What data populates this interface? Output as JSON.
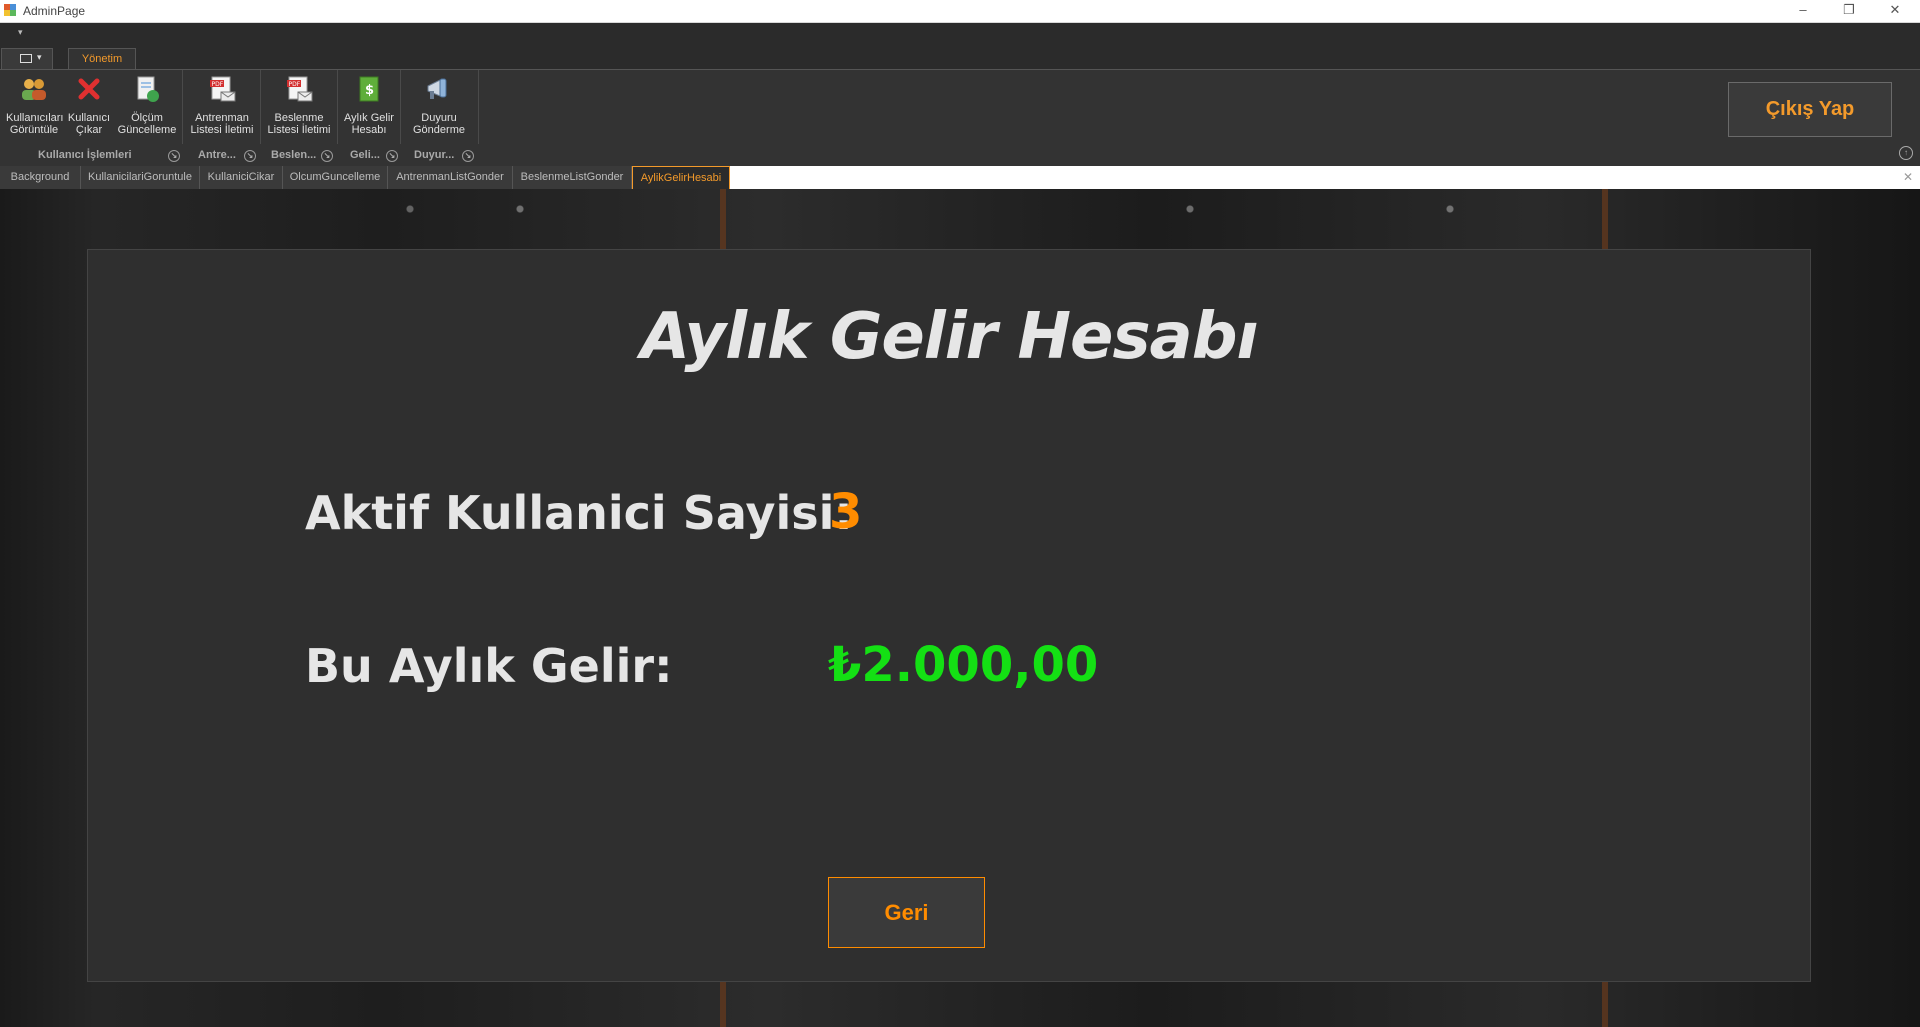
{
  "window": {
    "title": "AdminPage",
    "minimize_icon": "minimize-icon",
    "maximize_icon": "restore-icon",
    "close_icon": "close-icon"
  },
  "quick_access": {
    "icon": "customize-quick-access-icon"
  },
  "ribbon": {
    "tab_label": "Yönetim",
    "buttons": [
      {
        "label": "Kullanıcıları\nGörüntüle",
        "icon": "users-icon"
      },
      {
        "label": "Kullanıcı\nÇıkar",
        "icon": "red-x-icon"
      },
      {
        "label": "Ölçüm\nGüncelleme",
        "icon": "document-refresh-icon"
      },
      {
        "label": "Antrenman\nListesi İletimi",
        "icon": "pdf-mail-icon"
      },
      {
        "label": "Beslenme\nListesi İletimi",
        "icon": "pdf-mail-icon"
      },
      {
        "label": "Aylık Gelir\nHesabı",
        "icon": "money-document-icon"
      },
      {
        "label": "Duyuru\nGönderme",
        "icon": "megaphone-icon"
      }
    ],
    "groups": [
      "Kullanıcı İşlemleri",
      "Antre...",
      "Beslen...",
      "Geli...",
      "Duyur..."
    ],
    "logout_label": "Çıkış Yap"
  },
  "doc_tabs": [
    "Background",
    "KullanicilariGoruntule",
    "KullaniciCikar",
    "OlcumGuncelleme",
    "AntrenmanListGonder",
    "BeslenmeListGonder",
    "AylikGelirHesabi"
  ],
  "active_tab": "AylikGelirHesabi",
  "main": {
    "heading": "Aylık Gelir Hesabı",
    "active_users_label": "Aktif Kullanici Sayisi:",
    "active_users_value": "3",
    "monthly_income_label": "Bu Aylık Gelir:",
    "monthly_income_value": "₺2.000,00",
    "back_label": "Geri"
  },
  "colors": {
    "accent": "#ff8c00",
    "income": "#14e014",
    "panel": "#2f2f2f"
  }
}
